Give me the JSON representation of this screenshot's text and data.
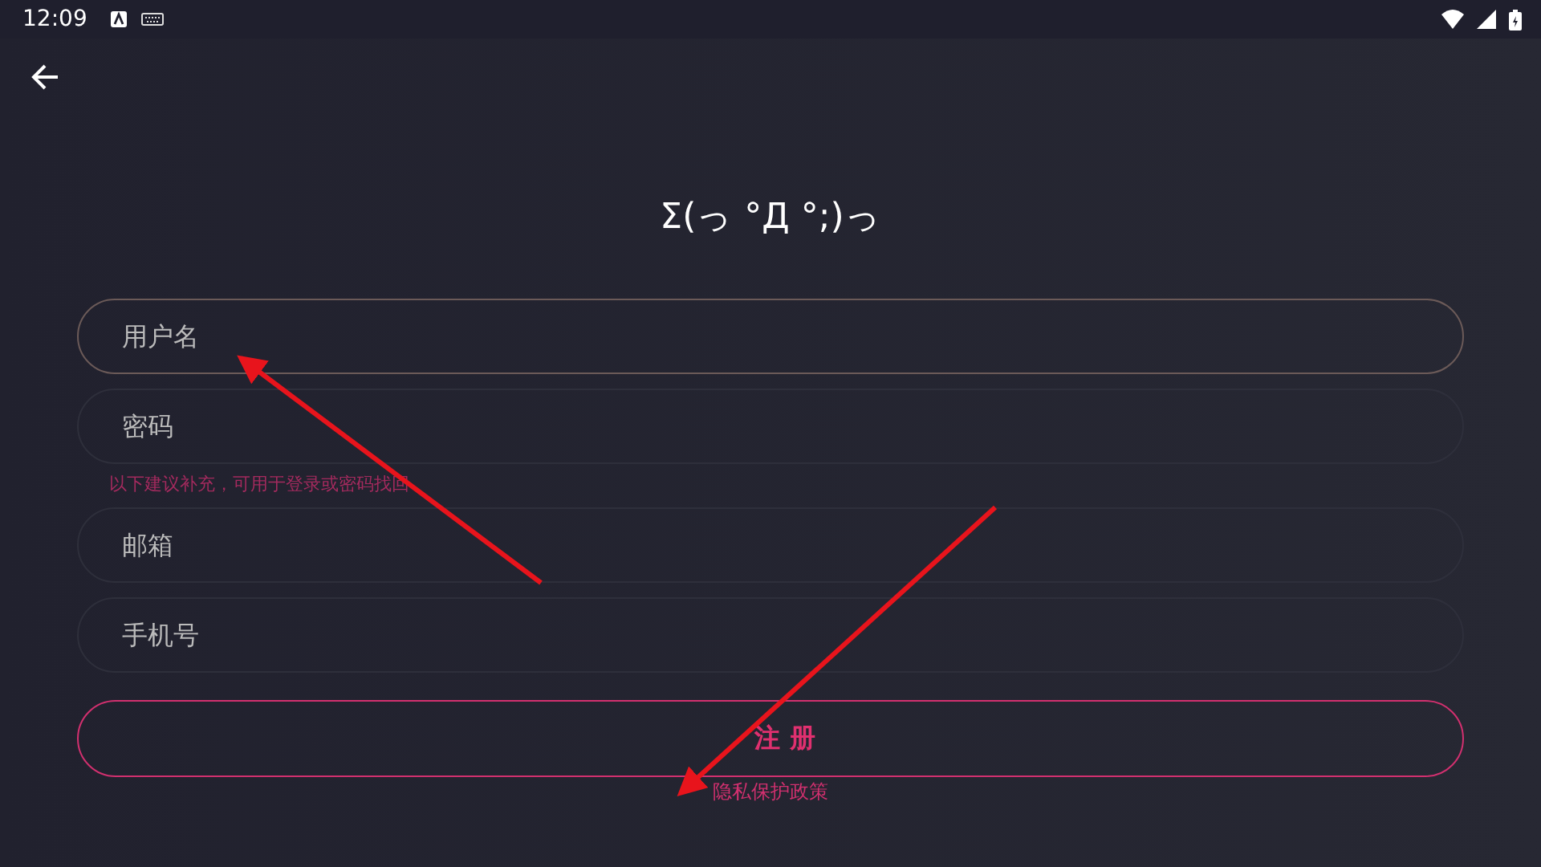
{
  "status_bar": {
    "time": "12:09"
  },
  "title": "Σ(っ °Д °;)っ",
  "fields": [
    {
      "placeholder": "用户名",
      "focused": true
    },
    {
      "placeholder": "密码",
      "focused": false
    }
  ],
  "hint": "以下建议补充，可用于登录或密码找回",
  "optional_fields": [
    {
      "placeholder": "邮箱",
      "focused": false
    },
    {
      "placeholder": "手机号",
      "focused": false
    }
  ],
  "register_button": "注 册",
  "privacy_link": "隐私保护政策"
}
